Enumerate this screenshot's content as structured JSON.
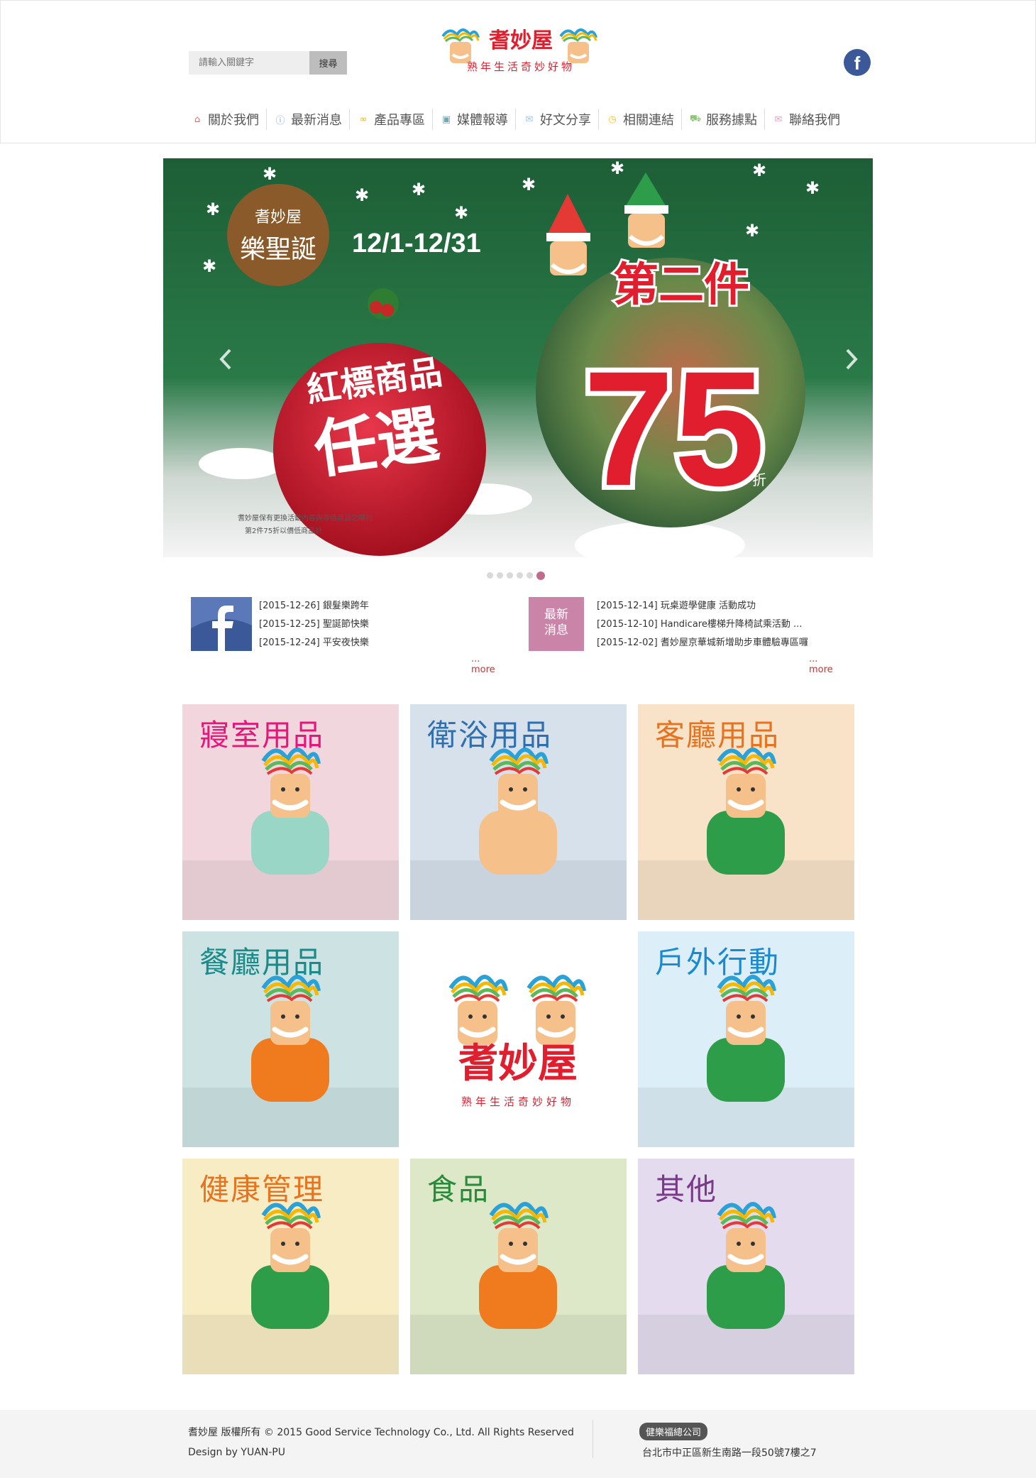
{
  "search": {
    "placeholder": "請輸入關鍵字",
    "button": "搜尋"
  },
  "brand": {
    "name": "耆妙屋",
    "tagline": "熟年生活奇妙好物"
  },
  "nav": [
    {
      "label": "關於我們",
      "icon": "home-icon",
      "color": "#e06666"
    },
    {
      "label": "最新消息",
      "icon": "info-icon",
      "color": "#6fa8dc"
    },
    {
      "label": "產品專區",
      "icon": "glasses-icon",
      "color": "#e6b800"
    },
    {
      "label": "媒體報導",
      "icon": "camera-icon",
      "color": "#76a5af"
    },
    {
      "label": "好文分享",
      "icon": "chat-icon",
      "color": "#9fc5e8"
    },
    {
      "label": "相關連結",
      "icon": "clock-icon",
      "color": "#f1c232"
    },
    {
      "label": "服務據點",
      "icon": "car-icon",
      "color": "#93c47d"
    },
    {
      "label": "聯絡我們",
      "icon": "mail-icon",
      "color": "#d5a6bd"
    }
  ],
  "banner": {
    "brand": "耆妙屋",
    "event": "樂聖誕",
    "dates": "12/1-12/31",
    "line1": "紅標商品",
    "line2": "任選",
    "second": "第二件",
    "discount": "75",
    "unit": "折",
    "note1": "耆妙屋保有更換活動內容與等值商品之權利",
    "note2": "第2件75折以價低商品計"
  },
  "carousel": {
    "count": 6,
    "active": 5
  },
  "facebook_news": {
    "items": [
      "[2015-12-26] 銀髮樂跨年",
      "[2015-12-25] 聖誕節快樂",
      "[2015-12-24] 平安夜快樂"
    ],
    "more": "... more"
  },
  "latest_news": {
    "thumb_label_1": "最新",
    "thumb_label_2": "消息",
    "items": [
      "[2015-12-14] 玩桌遊學健康 活動成功",
      "[2015-12-10] Handicare樓梯升降椅試乘活動 ...",
      "[2015-12-02] 耆妙屋京華城新增助步車體驗專區囉"
    ],
    "more": "... more"
  },
  "categories": [
    {
      "label": "寢室用品",
      "color": "#e6177a",
      "bg": "#f2d6dd"
    },
    {
      "label": "衛浴用品",
      "color": "#2f6fb0",
      "bg": "#d6e1ec"
    },
    {
      "label": "客廳用品",
      "color": "#e8731f",
      "bg": "#f8e3c8"
    },
    {
      "label": "餐廳用品",
      "color": "#1a8a8a",
      "bg": "#cde3e3"
    },
    {
      "label": "",
      "color": "#e01e2e",
      "bg": "#ffffff"
    },
    {
      "label": "戶外行動",
      "color": "#1a8ad0",
      "bg": "#dceef8"
    },
    {
      "label": "健康管理",
      "color": "#e8731f",
      "bg": "#f8ecc4"
    },
    {
      "label": "食品",
      "color": "#2a8a3a",
      "bg": "#dce8c8"
    },
    {
      "label": "其他",
      "color": "#7a3a8a",
      "bg": "#e4dcee"
    }
  ],
  "footer": {
    "copyright": "耆妙屋 版權所有 © 2015 Good Service Technology Co., Ltd. All Rights Reserved",
    "design": "Design by YUAN-PU",
    "company": "健樂福總公司",
    "address": "台北市中正區新生南路一段50號7樓之7"
  }
}
